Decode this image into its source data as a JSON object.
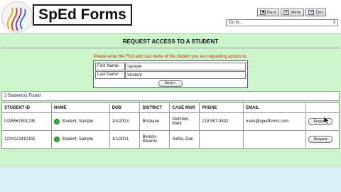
{
  "header": {
    "logo_text": "SpEd Forms",
    "nav_buttons": [
      {
        "label": "Back",
        "icon": "back-arrow-icon"
      },
      {
        "label": "Menu",
        "icon": "menu-icon"
      },
      {
        "label": "Quit",
        "icon": "quit-icon"
      }
    ],
    "goto_value": "Go to..."
  },
  "form": {
    "title": "REQUEST ACCESS TO A STUDENT",
    "instruction": "Please enter the First and Last name of the student you are requesting access to.",
    "first_name_label": "First Name:",
    "first_name_value": "Sample",
    "last_name_label": "Last Name:",
    "last_name_value": "Student",
    "next_label": "Next>>"
  },
  "results": {
    "count_text": "2 Student(s) Found",
    "columns": [
      "STUDENT ID",
      "NAME",
      "DOB",
      "DISTRICT",
      "CASE MGR",
      "PHONE",
      "EMAIL",
      ""
    ],
    "rows": [
      {
        "student_id": "0195567891235",
        "name": "Student, Sample",
        "dob": "1/4/2003",
        "district": "Brisbane",
        "case_mgr": "Oehrlein, Mark",
        "phone": "218 587-9832",
        "email": "mark@spedforms.com",
        "action": "Request"
      },
      {
        "student_id": "1234123412355",
        "name": "Student, Sample",
        "dob": "1/1/2001",
        "district": "Benton-Stearns",
        "case_mgr": "Salfer, Dan",
        "phone": "",
        "email": "",
        "action": "Request"
      }
    ]
  },
  "colors": {
    "panel_bg": "#ccf5cc",
    "instruction_text": "#cc2200",
    "status_icon": "#2fae2f",
    "bottom_bar": "#d6f1f7"
  }
}
